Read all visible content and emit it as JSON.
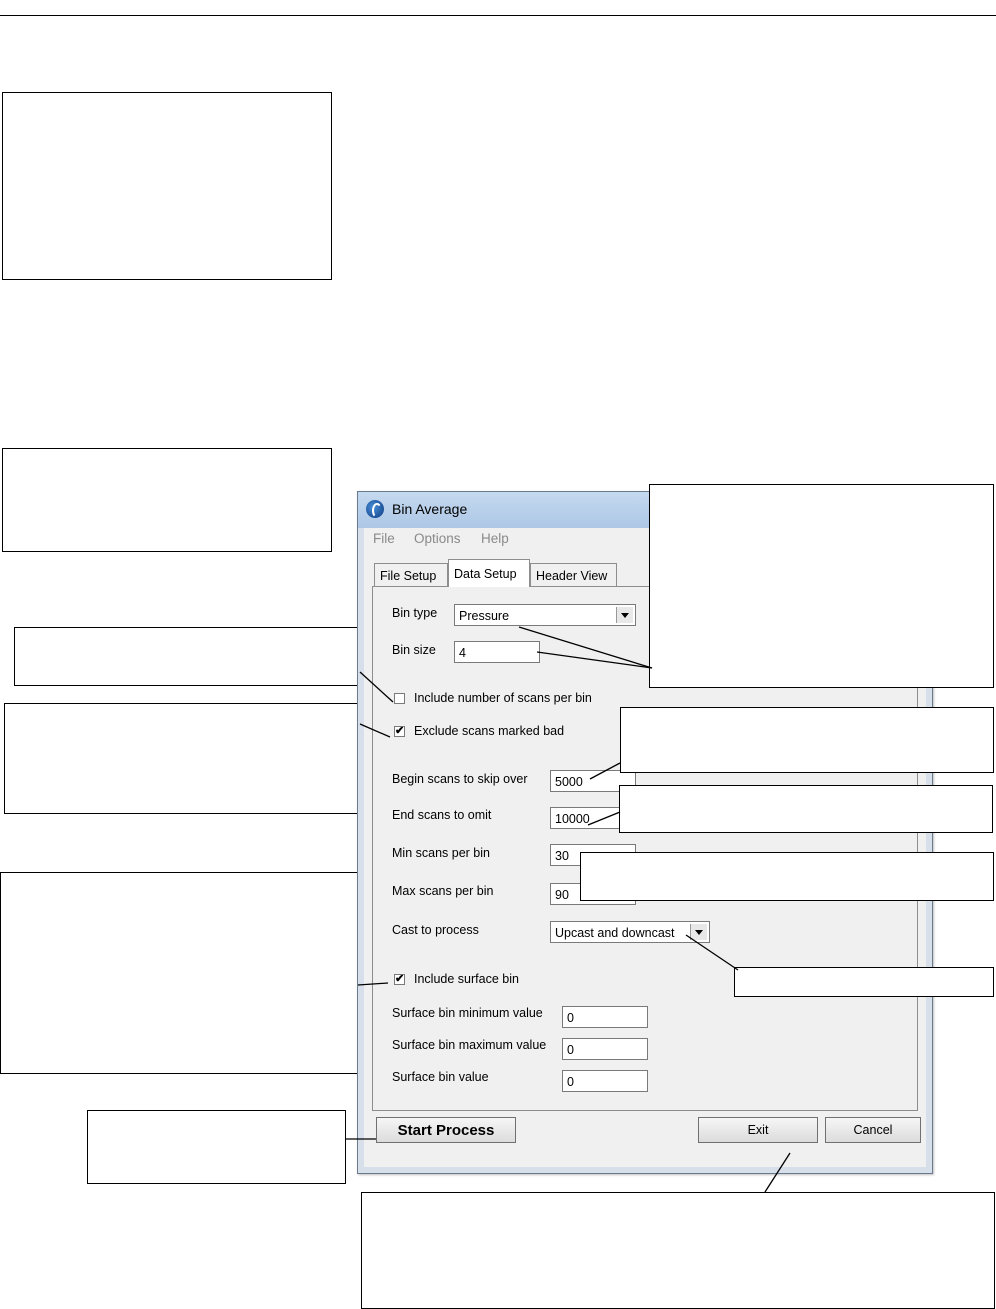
{
  "window": {
    "title": "Bin Average",
    "menu": [
      "File",
      "Options",
      "Help"
    ],
    "tabs": [
      "File Setup",
      "Data Setup",
      "Header View"
    ],
    "active_tab": "Data Setup"
  },
  "form": {
    "bin_type_label": "Bin type",
    "bin_type_value": "Pressure",
    "bin_size_label": "Bin size",
    "bin_size_value": "4",
    "include_scans_label": "Include number of scans per bin",
    "include_scans_checked": false,
    "exclude_bad_label": "Exclude scans marked bad",
    "exclude_bad_checked": true,
    "check_mark": "✔",
    "begin_skip_label": "Begin scans to skip over",
    "begin_skip_value": "5000",
    "end_omit_label": "End scans to omit",
    "end_omit_value": "10000",
    "min_scans_label": "Min scans per bin",
    "min_scans_value": "30",
    "max_scans_label": "Max scans per bin",
    "max_scans_value": "90",
    "cast_label": "Cast to process",
    "cast_value": "Upcast and downcast",
    "surface_bin_label": "Include surface bin",
    "surface_bin_checked": true,
    "surface_min_label": "Surface bin minimum value",
    "surface_min_value": "0",
    "surface_max_label": "Surface bin maximum value",
    "surface_max_value": "0",
    "surface_val_label": "Surface bin value",
    "surface_val_value": "0"
  },
  "buttons": {
    "start": "Start Process",
    "exit": "Exit",
    "cancel": "Cancel"
  },
  "colors": {
    "title_bar": "#b8cfe9",
    "window_face": "#f0f0f0"
  }
}
